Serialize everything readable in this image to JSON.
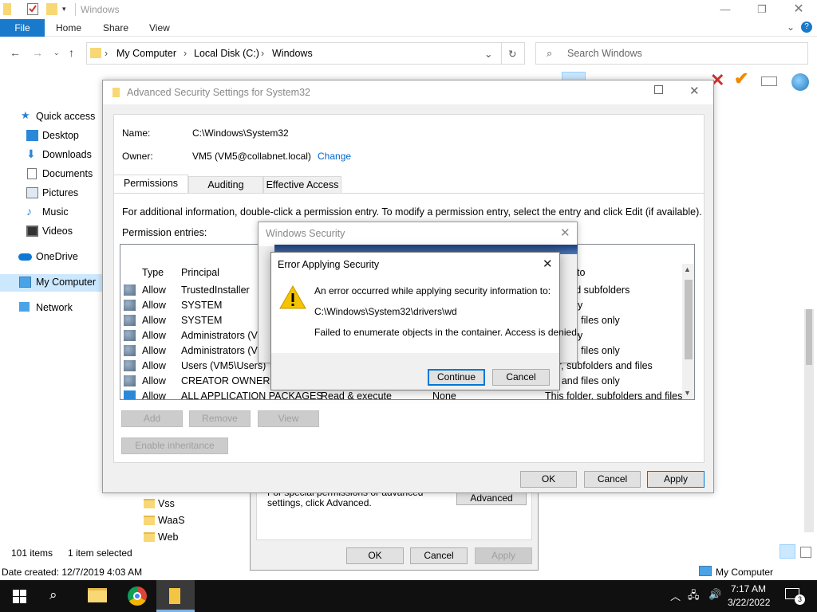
{
  "explorer": {
    "title": "Windows",
    "ribbon": {
      "file": "File",
      "tabs": [
        "Home",
        "Share",
        "View"
      ]
    },
    "address": {
      "segments": [
        "My Computer",
        "Local Disk (C:)",
        "Windows"
      ]
    },
    "search_placeholder": "Search Windows",
    "nav": {
      "quick_access": "Quick access",
      "desktop": "Desktop",
      "downloads": "Downloads",
      "documents": "Documents",
      "pictures": "Pictures",
      "music": "Music",
      "videos": "Videos",
      "onedrive": "OneDrive",
      "my_computer": "My Computer",
      "network": "Network"
    },
    "folders": [
      "Vss",
      "WaaS",
      "Web"
    ],
    "status": {
      "items": "101 items",
      "selected": "1 item selected",
      "date_created": "Date created: 12/7/2019 4:03 AM",
      "location": "My Computer"
    }
  },
  "properties_dialog": {
    "advanced_text": "For special permissions or advanced settings, click Advanced.",
    "advanced_button": "Advanced",
    "ok": "OK",
    "cancel": "Cancel",
    "apply": "Apply"
  },
  "adv_security": {
    "title": "Advanced Security Settings for System32",
    "name_label": "Name:",
    "name_value": "C:\\Windows\\System32",
    "owner_label": "Owner:",
    "owner_value": "VM5 (VM5@collabnet.local)",
    "change_link": "Change",
    "tabs": [
      "Permissions",
      "Auditing",
      "Effective Access"
    ],
    "info": "For additional information, double-click a permission entry. To modify a permission entry, select the entry and click Edit (if available).",
    "entries_label": "Permission entries:",
    "columns": {
      "type": "Type",
      "principal": "Principal",
      "applies_to": "to"
    },
    "entries": [
      {
        "type": "Allow",
        "principal": "TrustedInstaller",
        "access": "",
        "inherited": "",
        "applies": "lder and subfolders"
      },
      {
        "type": "Allow",
        "principal": "SYSTEM",
        "access": "",
        "inherited": "",
        "applies": "lder only"
      },
      {
        "type": "Allow",
        "principal": "SYSTEM",
        "access": "",
        "inherited": "",
        "applies": "ers and files only"
      },
      {
        "type": "Allow",
        "principal": "Administrators (VM",
        "access": "",
        "inherited": "",
        "applies": "lder only"
      },
      {
        "type": "Allow",
        "principal": "Administrators (VM",
        "access": "",
        "inherited": "",
        "applies": "ers and files only"
      },
      {
        "type": "Allow",
        "principal": "Users (VM5\\Users)",
        "access": "",
        "inherited": "",
        "applies": "lder, subfolders and files"
      },
      {
        "type": "Allow",
        "principal": "CREATOR OWNER",
        "access": "",
        "inherited": "",
        "applies": "ers and files only"
      },
      {
        "type": "Allow",
        "principal": "ALL APPLICATION PACKAGES",
        "access": "Read & execute",
        "inherited": "None",
        "applies": "This folder, subfolders and files"
      }
    ],
    "buttons": {
      "add": "Add",
      "remove": "Remove",
      "view": "View",
      "enable_inheritance": "Enable inheritance",
      "ok": "OK",
      "cancel": "Cancel",
      "apply": "Apply"
    }
  },
  "win_security": {
    "title": "Windows Security"
  },
  "error_dialog": {
    "title": "Error Applying Security",
    "line1": "An error occurred while applying security information to:",
    "path": "C:\\Windows\\System32\\drivers\\wd",
    "line2": "Failed to enumerate objects in the container. Access is denied.",
    "continue": "Continue",
    "cancel": "Cancel"
  },
  "taskbar": {
    "time": "7:17 AM",
    "date": "3/22/2022",
    "notifications": "3"
  },
  "colors": {
    "accent": "#0078d7",
    "file_tab": "#1979ca",
    "link": "#0066cc",
    "warning": "#f4c400"
  }
}
